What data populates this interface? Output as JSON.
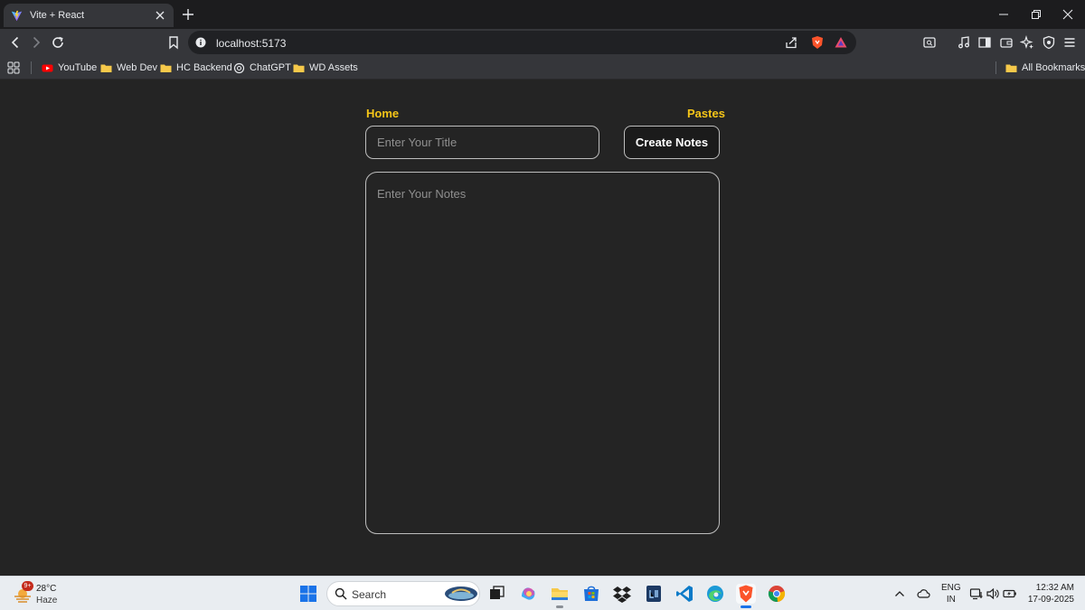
{
  "browser": {
    "tab_title": "Vite + React",
    "url": "localhost:5173",
    "bookmarks": [
      {
        "label": "YouTube",
        "icon": "youtube-icon"
      },
      {
        "label": "Web Dev",
        "icon": "folder-icon"
      },
      {
        "label": "HC Backend",
        "icon": "folder-icon"
      },
      {
        "label": "ChatGPT",
        "icon": "chatgpt-icon"
      },
      {
        "label": "WD Assets",
        "icon": "folder-icon"
      }
    ],
    "all_bookmarks_label": "All Bookmarks"
  },
  "app": {
    "nav": {
      "home_label": "Home",
      "pastes_label": "Pastes"
    },
    "title_placeholder": "Enter Your Title",
    "create_button_label": "Create Notes",
    "notes_placeholder": "Enter Your Notes",
    "accent_color": "#f5c518"
  },
  "taskbar": {
    "weather": {
      "temperature": "28°C",
      "condition": "Haze",
      "badge": "9+"
    },
    "search_label": "Search",
    "language": {
      "line1": "ENG",
      "line2": "IN"
    },
    "clock": {
      "time": "12:32 AM",
      "date": "17-09-2025"
    }
  }
}
